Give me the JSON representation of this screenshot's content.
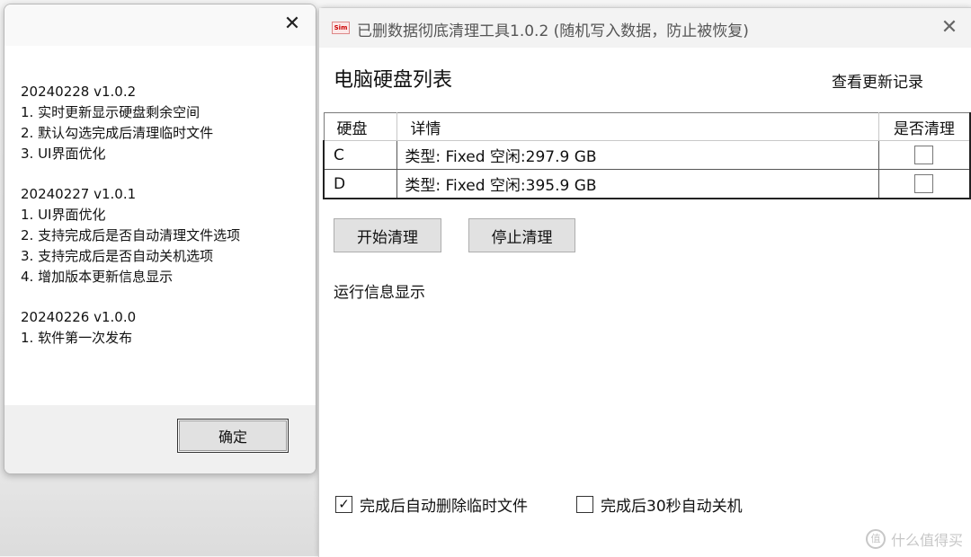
{
  "changelog_dialog": {
    "close_glyph": "✕",
    "entries": [
      {
        "version": "20240228 v1.0.2",
        "items": [
          "1. 实时更新显示硬盘剩余空间",
          "2. 默认勾选完成后清理临时文件",
          "3. UI界面优化"
        ]
      },
      {
        "version": "20240227 v1.0.1",
        "items": [
          "1. UI界面优化",
          "2. 支持完成后是否自动清理文件选项",
          "3. 支持完成后是否自动关机选项",
          "4. 增加版本更新信息显示"
        ]
      },
      {
        "version": "20240226 v1.0.0",
        "items": [
          "1. 软件第一次发布"
        ]
      }
    ],
    "ok_label": "确定"
  },
  "main_window": {
    "app_icon_text": "Sim",
    "title": "已删数据彻底清理工具1.0.2 (随机写入数据，防止被恢复)",
    "close_glyph": "✕",
    "heading": "电脑硬盘列表",
    "changelog_link": "查看更新记录",
    "table": {
      "headers": [
        "硬盘",
        "详情",
        "是否清理"
      ],
      "rows": [
        {
          "drive": "C",
          "detail": "类型: Fixed 空闲:297.9 GB",
          "checked": false
        },
        {
          "drive": "D",
          "detail": "类型: Fixed 空闲:395.9 GB",
          "checked": false
        }
      ]
    },
    "start_button": "开始清理",
    "stop_button": "停止清理",
    "run_info_label": "运行信息显示",
    "options": [
      {
        "label": "完成后自动删除临时文件",
        "checked": true
      },
      {
        "label": "完成后30秒自动关机",
        "checked": false
      }
    ]
  },
  "watermark": {
    "icon": "值",
    "text": "什么值得买"
  }
}
